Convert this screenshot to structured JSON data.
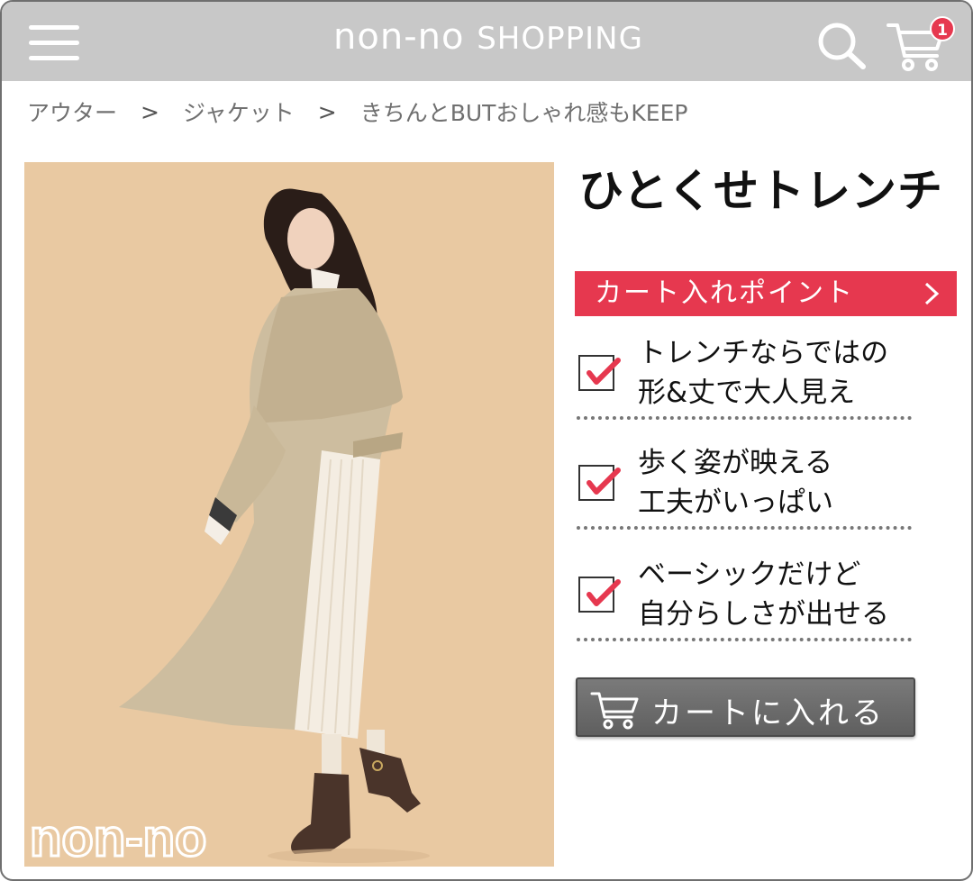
{
  "header": {
    "brand_main": "non-no",
    "brand_shop": "SHOPPING",
    "cart_count": "1"
  },
  "breadcrumb": [
    "アウター",
    "ジャケット",
    "きちんとBUTおしゃれ感もKEEP"
  ],
  "photo": {
    "watermark": "non-no",
    "background_color": "#e9c9a2"
  },
  "product": {
    "title": "ひとくせトレンチ"
  },
  "points_header": "カート入れポイント",
  "points": [
    {
      "line1": "トレンチならではの",
      "line2": "形&丈で大人見え"
    },
    {
      "line1": "歩く姿が映える",
      "line2": "工夫がいっぱい"
    },
    {
      "line1": "ベーシックだけど",
      "line2": "自分らしさが出せる"
    }
  ],
  "cart_button": {
    "label": "カートに入れる"
  },
  "colors": {
    "accent": "#e6384f",
    "header_bg": "#c8c8c8",
    "button_bg": "#6e6e6e"
  }
}
